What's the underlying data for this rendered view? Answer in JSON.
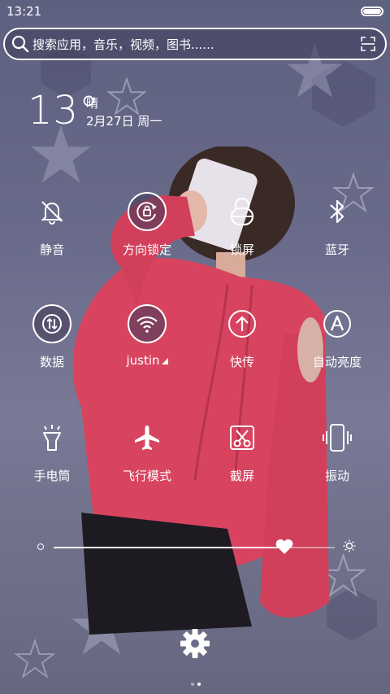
{
  "status_bar": {
    "time": "13:21",
    "battery_level": 1.0
  },
  "search": {
    "placeholder": "搜索应用，音乐，视频，图书......"
  },
  "weather": {
    "temperature": "13°",
    "condition": "晴",
    "date": "2月27日 周一"
  },
  "toggles": [
    {
      "label": "静音",
      "icon": "bell-off-icon",
      "active": false
    },
    {
      "label": "方向锁定",
      "icon": "rotation-lock-icon",
      "active": true
    },
    {
      "label": "锁屏",
      "icon": "lock-icon",
      "active": false
    },
    {
      "label": "蓝牙",
      "icon": "bluetooth-icon",
      "active": false
    },
    {
      "label": "数据",
      "icon": "mobile-data-icon",
      "active": true
    },
    {
      "label": "justin",
      "icon": "wifi-icon",
      "active": true
    },
    {
      "label": "快传",
      "icon": "quick-transfer-icon",
      "active": false
    },
    {
      "label": "自动亮度",
      "icon": "auto-brightness-icon",
      "active": false
    },
    {
      "label": "手电筒",
      "icon": "flashlight-icon",
      "active": false
    },
    {
      "label": "飞行模式",
      "icon": "airplane-icon",
      "active": false
    },
    {
      "label": "截屏",
      "icon": "screenshot-icon",
      "active": false
    },
    {
      "label": "振动",
      "icon": "vibrate-icon",
      "active": false
    }
  ],
  "brightness": {
    "level": 0.82
  },
  "pager": {
    "pages": 2,
    "current": 2
  },
  "colors": {
    "background": "#65667f",
    "shirt": "#d8445f"
  }
}
